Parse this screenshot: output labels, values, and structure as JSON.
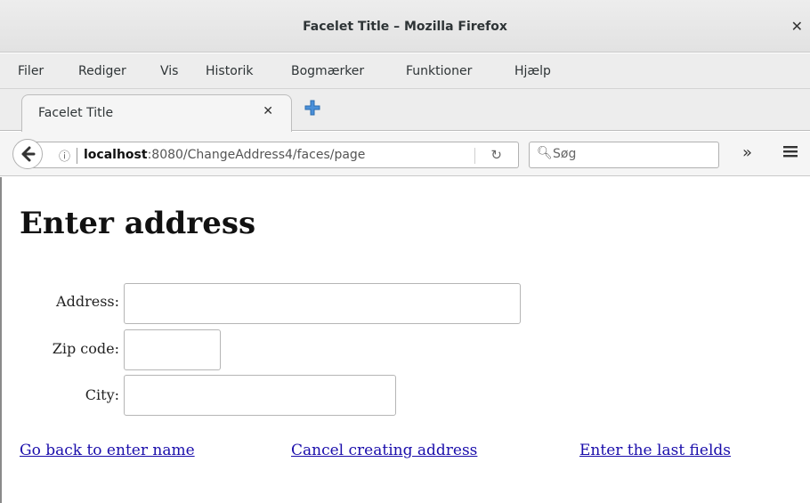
{
  "window": {
    "title": "Facelet Title – Mozilla Firefox"
  },
  "menu": [
    "Filer",
    "Rediger",
    "Vis",
    "Historik",
    "Bogmærker",
    "Funktioner",
    "Hjælp"
  ],
  "tab": {
    "label": "Facelet Title"
  },
  "urlbar": {
    "host": "localhost",
    "rest": ":8080/ChangeAddress4/faces/page"
  },
  "search": {
    "placeholder": "Søg"
  },
  "page": {
    "heading": "Enter address",
    "labels": {
      "address": "Address:",
      "zip": "Zip code:",
      "city": "City:"
    },
    "links": [
      "Go back to enter name",
      "Cancel creating address",
      "Enter the last fields"
    ]
  }
}
